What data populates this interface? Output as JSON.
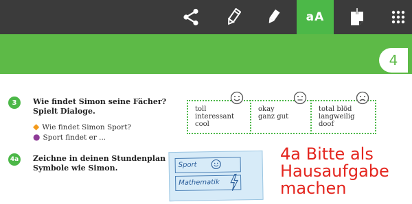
{
  "toolbar": {
    "buttons": [
      {
        "icon": "share-icon"
      },
      {
        "icon": "pencil-icon"
      },
      {
        "icon": "marker-icon"
      },
      {
        "icon": "text-size-icon",
        "label": "aA",
        "active": true
      },
      {
        "icon": "sticky-note-icon"
      },
      {
        "icon": "apps-grid-icon"
      }
    ]
  },
  "page_number": "4",
  "tasks": [
    {
      "number": "3",
      "text_line1": "Wie findet Simon seine Fächer?",
      "text_line2": "Spielt Dialoge."
    },
    {
      "number": "4a",
      "text_line1": "Zeichne in deinen Stundenplan",
      "text_line2": "Symbole wie Simon."
    }
  ],
  "bullets": [
    {
      "text": "Wie findet Simon Sport?",
      "color": "#f39a1b"
    },
    {
      "text": "Sport findet er ...",
      "color": "#8e3b97"
    }
  ],
  "rating_boxes": [
    {
      "face": "happy",
      "lines": [
        "toll",
        "interessant",
        "cool"
      ]
    },
    {
      "face": "neutral",
      "lines": [
        "okay",
        "ganz gut",
        ""
      ]
    },
    {
      "face": "sad",
      "lines": [
        "total blöd",
        "langweilig",
        "doof"
      ]
    }
  ],
  "timetable_example": {
    "rows": [
      "Sport",
      "Mathematik"
    ]
  },
  "handwritten_note": {
    "lines": [
      "4a Bitte als",
      "Hausaufgabe",
      "machen"
    ],
    "color": "#e4261f"
  },
  "colors": {
    "toolbar": "#3b3b3b",
    "accent_green": "#5dba47",
    "active_button": "#4cb848"
  }
}
